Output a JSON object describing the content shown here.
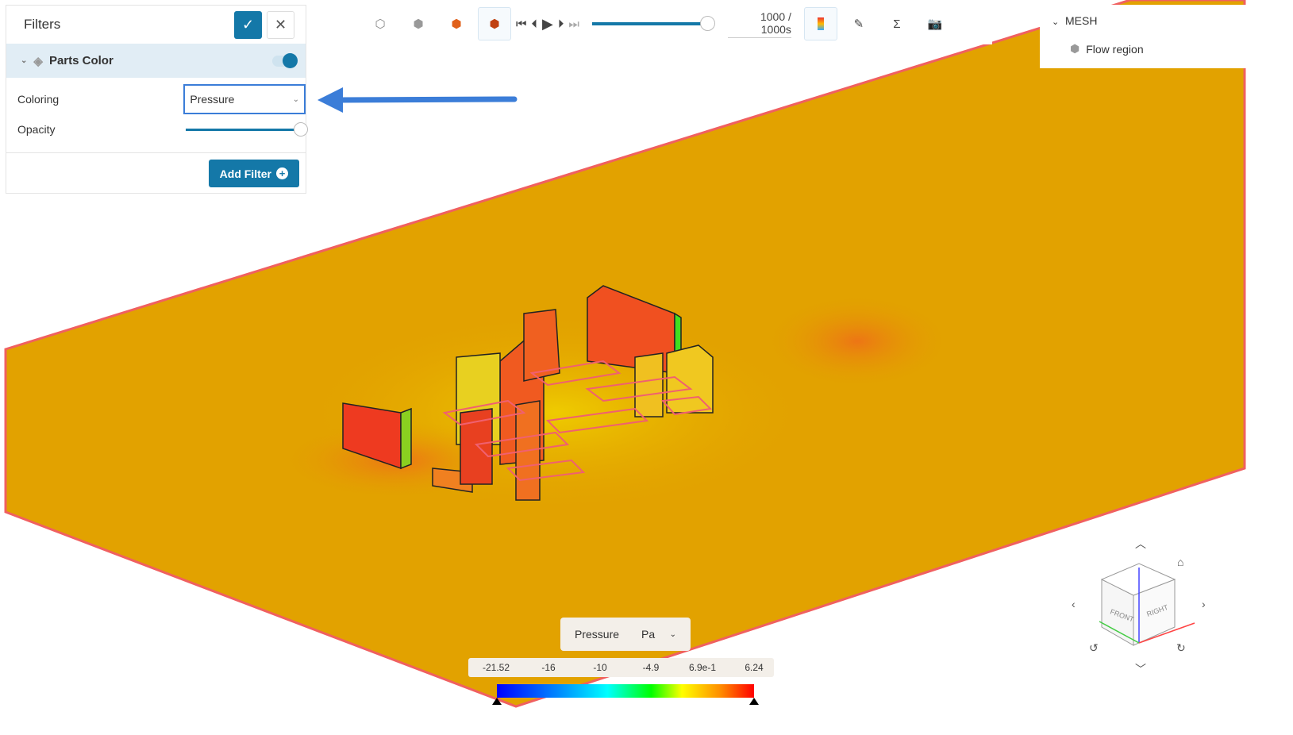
{
  "filters": {
    "title": "Filters",
    "parts_color": {
      "label": "Parts Color",
      "enabled": true
    },
    "coloring": {
      "label": "Coloring",
      "value": "Pressure"
    },
    "opacity": {
      "label": "Opacity",
      "value": 1.0
    },
    "add_filter_label": "Add Filter"
  },
  "toolbar": {
    "time": "1000 / 1000s",
    "progress": 1.0
  },
  "tree": {
    "root": "MESH",
    "child": "Flow region"
  },
  "legend": {
    "quantity": "Pressure",
    "unit": "Pa",
    "ticks": [
      "-21.52",
      "-16",
      "-10",
      "-4.9",
      "6.9e-1",
      "6.24"
    ]
  },
  "navcube": {
    "front": "FRONT",
    "right": "RIGHT"
  },
  "colors": {
    "accent": "#1478a8",
    "plane": "#e2a200",
    "arrow": "#3b7dd8"
  }
}
